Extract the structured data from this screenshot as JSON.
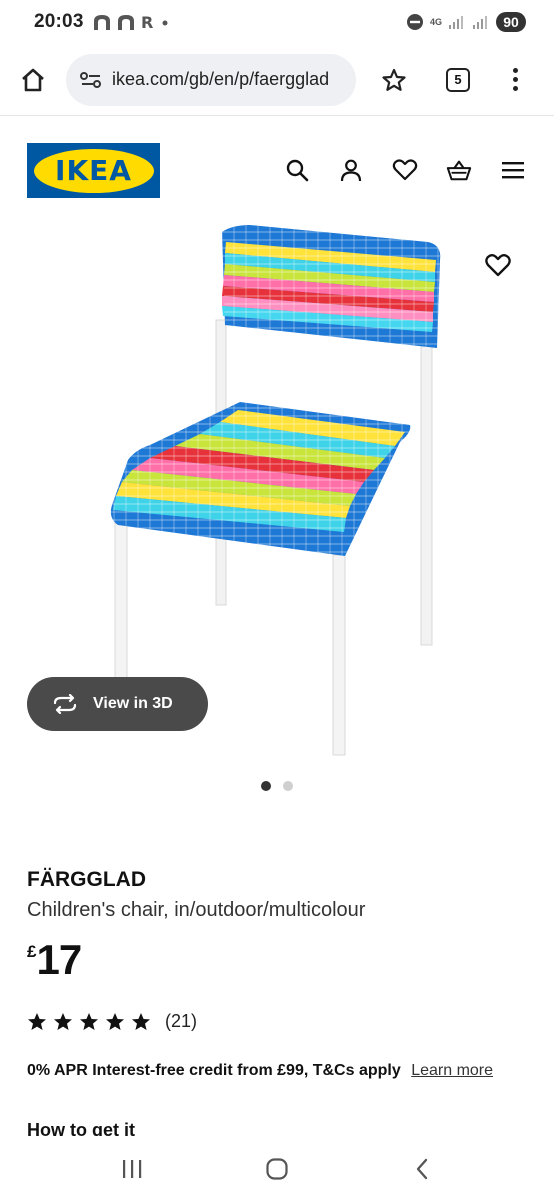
{
  "status_bar": {
    "time": "20:03",
    "battery": "90",
    "network": "4G"
  },
  "browser": {
    "url": "ikea.com/gb/en/p/faergglad",
    "tab_count": "5"
  },
  "site": {
    "logo_text": "IKEA",
    "brand_blue": "#0058a3",
    "brand_yellow": "#ffdb00"
  },
  "product": {
    "view3d_label": "View in 3D",
    "image_count": 2,
    "active_image": 1,
    "name": "FÄRGGLAD",
    "description": "Children's chair, in/outdoor/multicolour",
    "currency": "£",
    "price": "17",
    "rating_stars": 5,
    "rating_count": "(21)",
    "credit_text": "0% APR Interest-free credit from £99, T&Cs apply",
    "learn_more": "Learn more",
    "how_to_get": "How to get it"
  }
}
